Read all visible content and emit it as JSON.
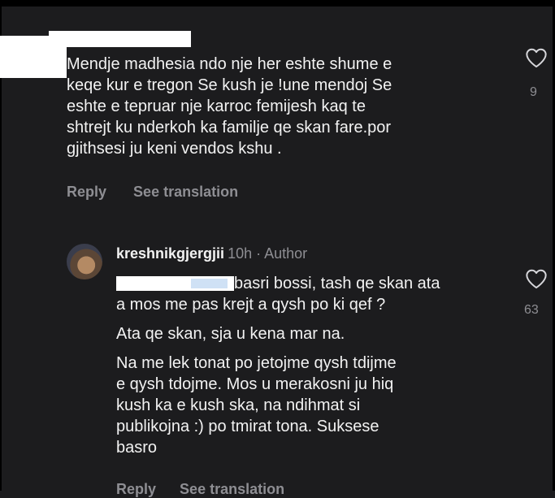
{
  "comment1": {
    "lines": [
      "Mendje madhesia ndo nje her eshte shume e",
      "keqe kur e tregon Se kush je !une mendoj Se",
      "eshte e tepruar nje karroc femijesh kaq te",
      "shtrejt ku nderkoh ka familje qe skan fare.por",
      "gjithsesi ju keni vendos kshu ."
    ],
    "reply_label": "Reply",
    "translate_label": "See translation",
    "likes": "9"
  },
  "reply": {
    "username": "kreshnikgjergjii",
    "meta": "10h · Author",
    "para1": [
      "basri bossi, tash qe skan ata",
      "a mos me pas krejt a qysh po ki qef ?"
    ],
    "para2": "Ata qe skan, sja u kena mar na.",
    "para3": [
      "Na me lek tonat po jetojme qysh tdijme",
      "e qysh tdojme. Mos u merakosni ju hiq",
      "kush ka e kush ska, na ndihmat si",
      "publikojna :) po tmirat tona. Suksese",
      "basro"
    ],
    "likes": "63",
    "reply_label": "Reply",
    "translate_label": "See translation"
  },
  "icons": {
    "like": "heart-outline-icon"
  },
  "colors": {
    "background": "#1c1c1e",
    "muted": "#8e8e93",
    "text": "#f2f2f2"
  }
}
